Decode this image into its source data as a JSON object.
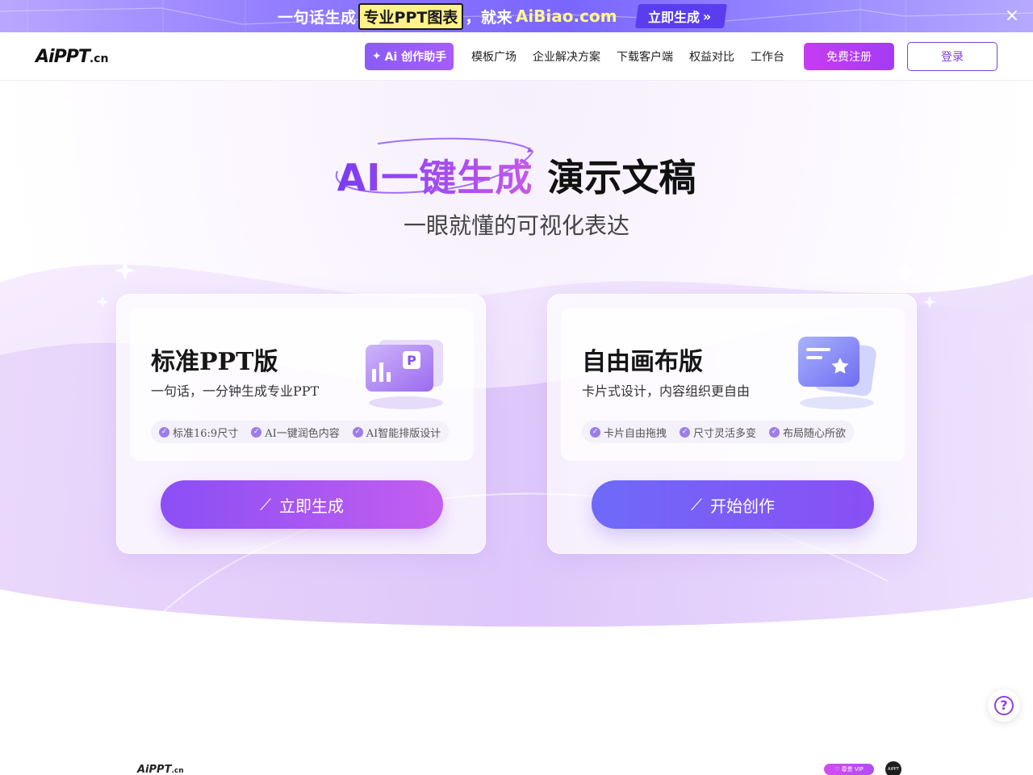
{
  "promo": {
    "text_before": "一句话生成",
    "highlight": "专业PPT图表",
    "text_middle": "，就来",
    "domain": "AiBiao.com",
    "cta_label": "立即生成",
    "cta_arrow": "»",
    "close_icon": "×"
  },
  "header": {
    "logo_main": "AiPPT",
    "logo_suffix": ".cn",
    "ai_button_icon": "✦",
    "ai_button_label": "Ai 创作助手",
    "nav": [
      "模板广场",
      "企业解决方案",
      "下载客户端",
      "权益对比",
      "工作台"
    ],
    "register_label": "免费注册",
    "login_label": "登录"
  },
  "hero": {
    "title_gradient": "AI一键生成",
    "title_dark": "演示文稿",
    "subtitle": "一眼就懂的可视化表达"
  },
  "cards": [
    {
      "title": "标准PPT版",
      "description": "一句话，一分钟生成专业PPT",
      "tags": [
        "标准16:9尺寸",
        "AI一键润色内容",
        "AI智能排版设计"
      ],
      "button_label": "立即生成",
      "icon": "ppt-chart-icon"
    },
    {
      "title": "自由画布版",
      "description": "卡片式设计，内容组织更自由",
      "tags": [
        "卡片自由拖拽",
        "尺寸灵活多变",
        "布局随心所欲"
      ],
      "button_label": "开始创作",
      "icon": "canvas-card-icon"
    }
  ],
  "help_icon": "?",
  "footer": {
    "logo_main": "AiPPT",
    "logo_suffix": ".cn",
    "vip_badge": "♡ 尊贵 VIP",
    "avatar_text": "AiPPT"
  },
  "colors": {
    "brand_purple": "#8a4ff4",
    "brand_magenta": "#c45ef0",
    "promo_yellow": "#fff28a"
  }
}
